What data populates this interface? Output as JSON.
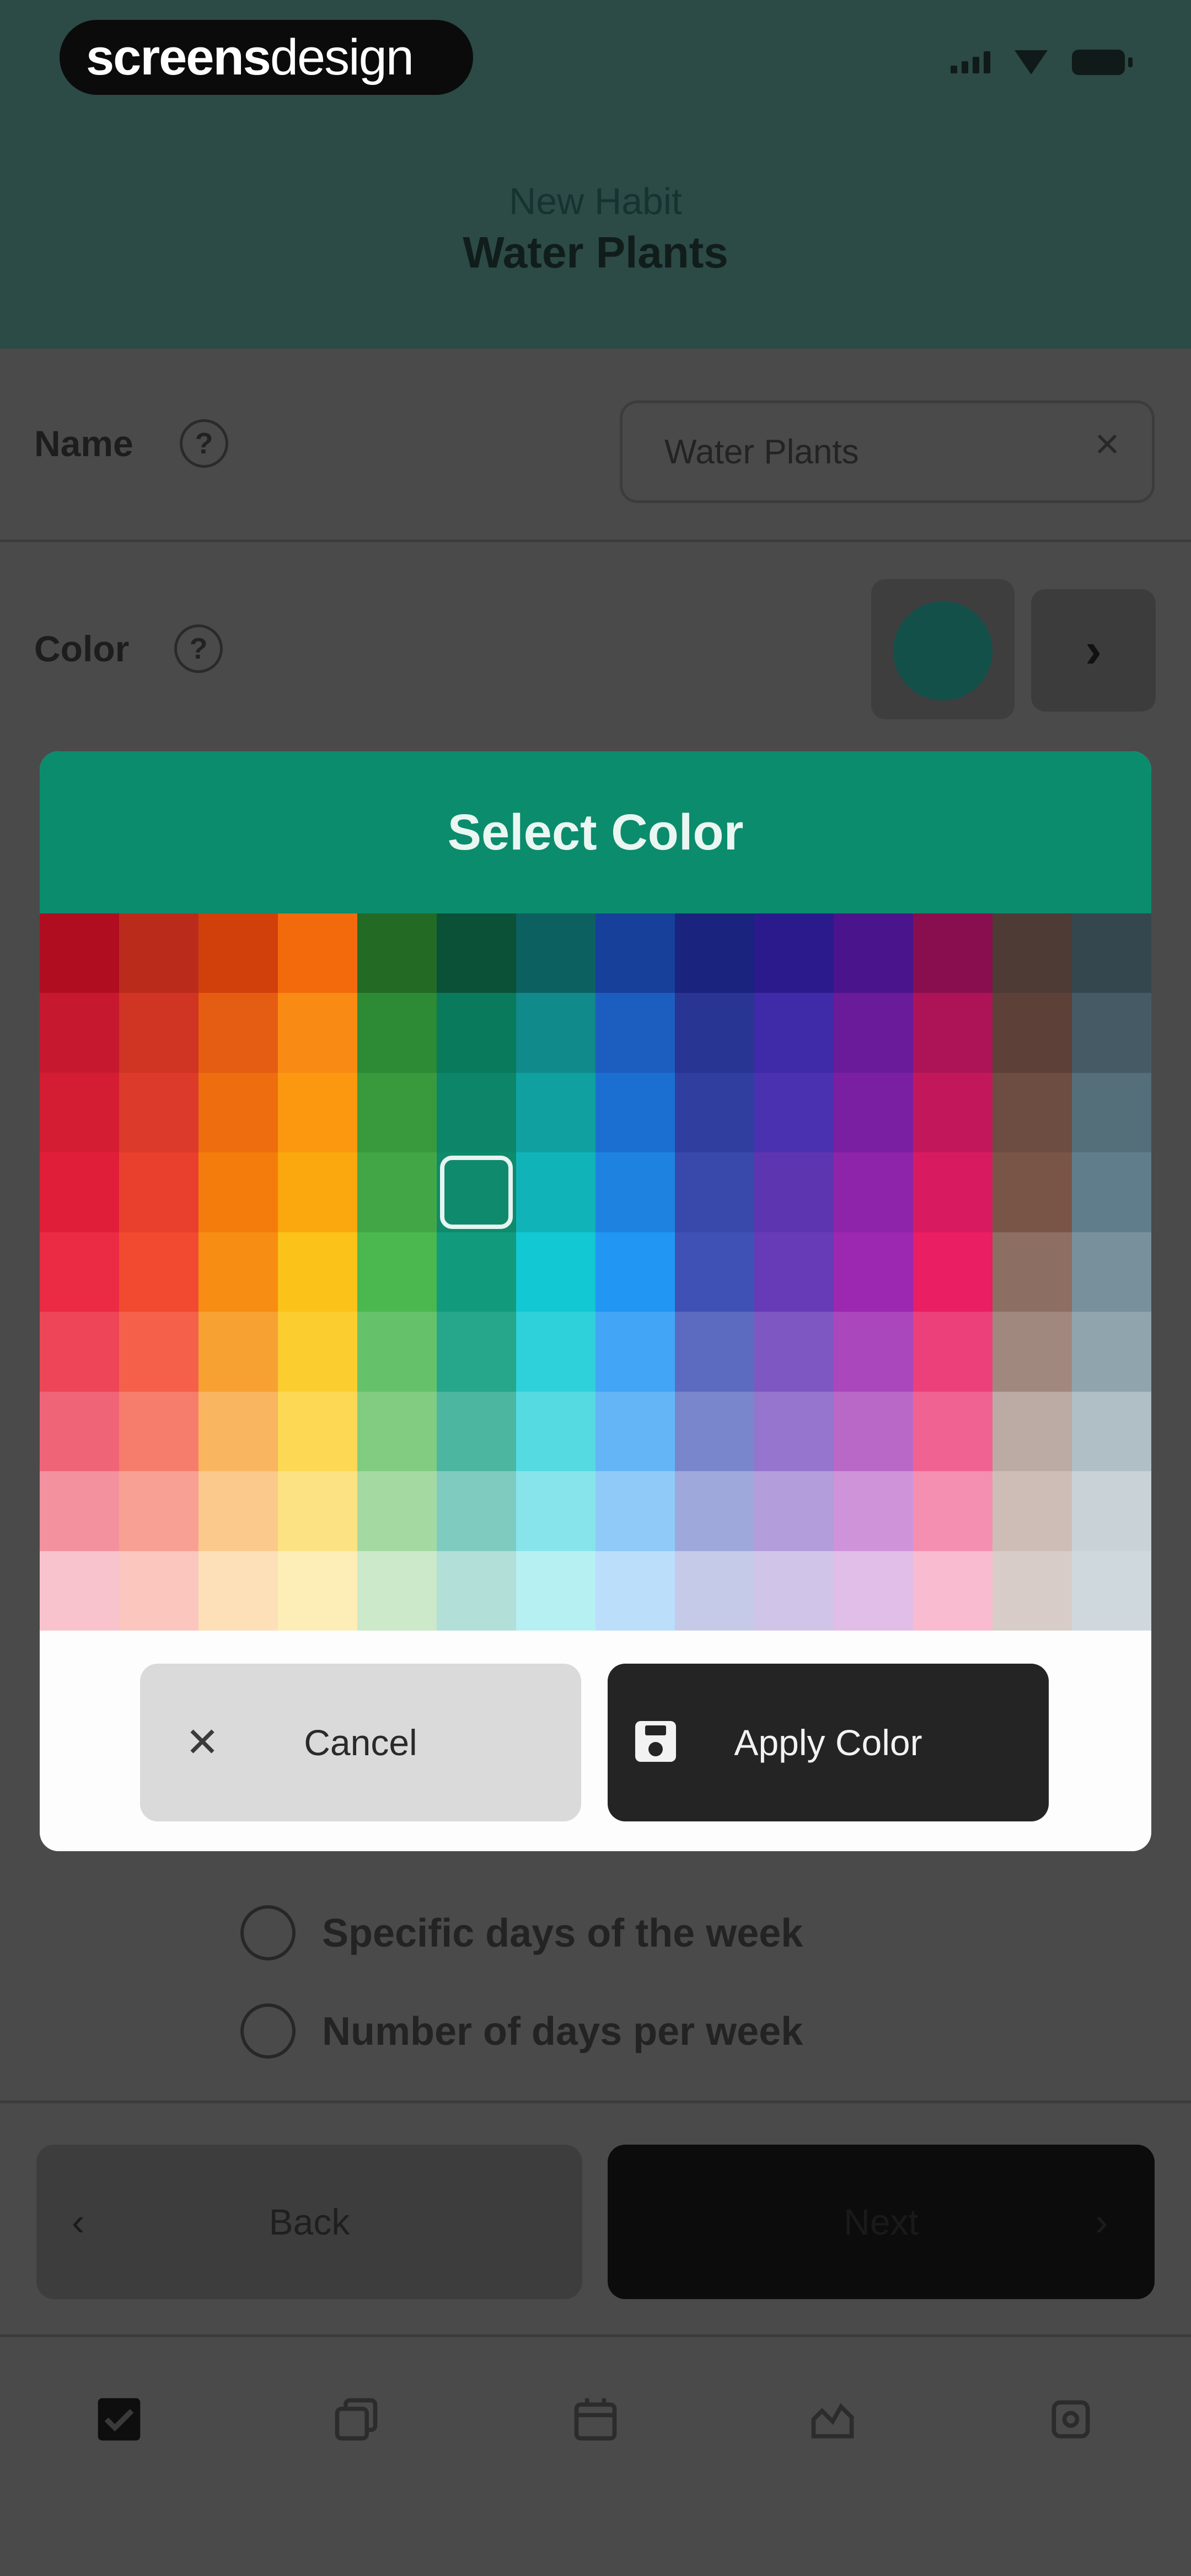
{
  "status_bar": {
    "brand_bold": "screens",
    "brand_light": "design",
    "icons": [
      "signal-icon",
      "wifi-icon",
      "battery-icon"
    ]
  },
  "header": {
    "subtitle": "New Habit",
    "title": "Water Plants"
  },
  "form": {
    "name_label": "Name",
    "name_help": "?",
    "name_value": "Water Plants",
    "color_label": "Color",
    "color_help": "?",
    "current_color": "#14504a",
    "frequency_options": [
      {
        "label": "Specific days of the week",
        "selected": false
      },
      {
        "label": "Number of days per week",
        "selected": false
      }
    ]
  },
  "nav_buttons": {
    "back_label": "Back",
    "next_label": "Next"
  },
  "tabbar": {
    "items": [
      "habits-tab-icon",
      "copy-tab-icon",
      "calendar-tab-icon",
      "stats-tab-icon",
      "settings-tab-icon"
    ],
    "active_index": 0
  },
  "modal": {
    "title": "Select Color",
    "header_color": "#0b8c6c",
    "cancel_label": "Cancel",
    "apply_label": "Apply Color",
    "selected_row": 3,
    "selected_col": 5,
    "palette": [
      [
        "#b00d21",
        "#bb2b1c",
        "#d13f0b",
        "#f36a0d",
        "#236a25",
        "#0a5138",
        "#0d6060",
        "#16409a",
        "#1a237e",
        "#2b1a8c",
        "#4a148c",
        "#880e4f",
        "#4e3b36",
        "#34474f"
      ],
      [
        "#c61930",
        "#d03423",
        "#e55d12",
        "#f98b14",
        "#2d8a35",
        "#0a7a5c",
        "#108a8a",
        "#1c5ec0",
        "#283593",
        "#3f2aa8",
        "#6a1b9a",
        "#ad1457",
        "#5d4037",
        "#455a64"
      ],
      [
        "#d41d33",
        "#dc3a2a",
        "#ee6d0e",
        "#fb980f",
        "#389a3c",
        "#0d8569",
        "#10a0a0",
        "#1a6fd0",
        "#303f9f",
        "#4a31b0",
        "#7b1fa2",
        "#c2185b",
        "#6d4c41",
        "#546e7a"
      ],
      [
        "#e11e39",
        "#e8402c",
        "#f47c0c",
        "#fba80f",
        "#43a646",
        "#0f8a6d",
        "#10b4b8",
        "#1e82e0",
        "#3949ab",
        "#5e35b1",
        "#8e24aa",
        "#d81b60",
        "#795548",
        "#607d8b"
      ],
      [
        "#eb2a44",
        "#f14a30",
        "#f88d13",
        "#fbc21a",
        "#4ab84e",
        "#129a7c",
        "#12c8d2",
        "#2196f3",
        "#3f51b5",
        "#673ab7",
        "#9c27b0",
        "#e91e63",
        "#8d6e63",
        "#78909c"
      ],
      [
        "#ee4558",
        "#f5604a",
        "#f8a133",
        "#fbcd2f",
        "#66c26a",
        "#26a68a",
        "#2ed1da",
        "#42a5f5",
        "#5c6bc0",
        "#7e57c2",
        "#ab47bc",
        "#ec407a",
        "#a1887f",
        "#90a4ae"
      ],
      [
        "#f06478",
        "#f67d6c",
        "#f9b560",
        "#fcd855",
        "#82cc82",
        "#4db6a0",
        "#55dae2",
        "#64b5f6",
        "#7986cb",
        "#9575cd",
        "#ba68c8",
        "#f06292",
        "#bcaaa4",
        "#b0bec5"
      ],
      [
        "#f3919f",
        "#f9a094",
        "#fbc98c",
        "#fde283",
        "#a5d9a2",
        "#80cbc0",
        "#86e4ea",
        "#90caf9",
        "#9fa8da",
        "#b39ddb",
        "#ce93d8",
        "#f48fb1",
        "#cdbdb6",
        "#c8d2d7"
      ],
      [
        "#f8c3cc",
        "#fbc6bd",
        "#fde0b8",
        "#fdedb6",
        "#cce9c9",
        "#b2dfd8",
        "#b6f0f2",
        "#bbdefb",
        "#c5cae9",
        "#d1c4e9",
        "#e1bee7",
        "#f8bbd0",
        "#d7ccc8",
        "#cfd8dc"
      ]
    ]
  }
}
